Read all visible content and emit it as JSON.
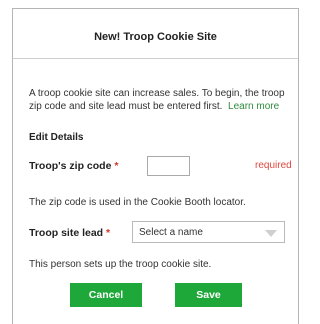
{
  "dialog": {
    "title": "New! Troop Cookie Site",
    "intro_text": "A troop cookie site can increase sales. To begin, the troop zip code and site lead must be entered first.",
    "learn_more": "Learn more",
    "section_title": "Edit Details"
  },
  "zip": {
    "label": "Troop's zip code",
    "required_star": "*",
    "value": "",
    "required_text": "required",
    "help": "The zip code is used in the Cookie Booth locator."
  },
  "lead": {
    "label": "Troop site lead",
    "required_star": "*",
    "selected": "Select a name",
    "help": "This person sets up the troop cookie site."
  },
  "buttons": {
    "cancel": "Cancel",
    "save": "Save"
  },
  "colors": {
    "accent_green": "#1fa83a",
    "link_green": "#2e8b3d",
    "required_red": "#e0483f"
  }
}
